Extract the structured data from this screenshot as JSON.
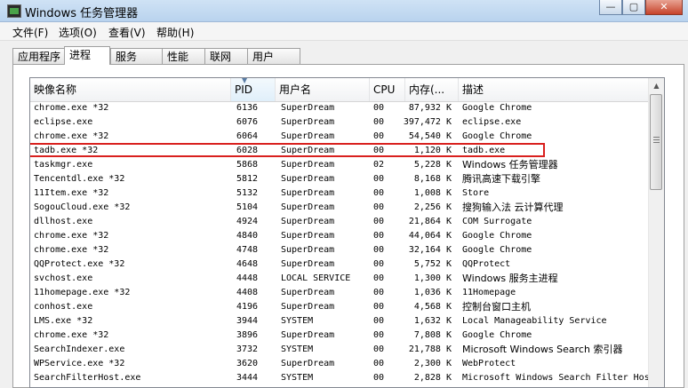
{
  "window": {
    "title": "Windows 任务管理器",
    "minimize": "—",
    "maximize": "▢",
    "close": "✕"
  },
  "menu": [
    "文件(F)",
    "选项(O)",
    "查看(V)",
    "帮助(H)"
  ],
  "tabs": [
    "应用程序",
    "进程",
    "服务",
    "性能",
    "联网",
    "用户"
  ],
  "active_tab": "进程",
  "columns": {
    "name": "映像名称",
    "pid": "PID",
    "user": "用户名",
    "cpu": "CPU",
    "mem": "内存(...",
    "desc": "描述"
  },
  "processes": [
    {
      "name": "chrome.exe *32",
      "pid": "6136",
      "user": "SuperDream",
      "cpu": "00",
      "mem": "87,932 K",
      "desc": "Google Chrome"
    },
    {
      "name": "eclipse.exe",
      "pid": "6076",
      "user": "SuperDream",
      "cpu": "00",
      "mem": "397,472 K",
      "desc": "eclipse.exe"
    },
    {
      "name": "chrome.exe *32",
      "pid": "6064",
      "user": "SuperDream",
      "cpu": "00",
      "mem": "54,540 K",
      "desc": "Google Chrome"
    },
    {
      "name": "tadb.exe *32",
      "pid": "6028",
      "user": "SuperDream",
      "cpu": "00",
      "mem": "1,120 K",
      "desc": "tadb.exe"
    },
    {
      "name": "taskmgr.exe",
      "pid": "5868",
      "user": "SuperDream",
      "cpu": "02",
      "mem": "5,228 K",
      "desc": "Windows 任务管理器"
    },
    {
      "name": "Tencentdl.exe *32",
      "pid": "5812",
      "user": "SuperDream",
      "cpu": "00",
      "mem": "8,168 K",
      "desc": "腾讯高速下载引擎"
    },
    {
      "name": "11Item.exe *32",
      "pid": "5132",
      "user": "SuperDream",
      "cpu": "00",
      "mem": "1,008 K",
      "desc": "Store"
    },
    {
      "name": "SogouCloud.exe *32",
      "pid": "5104",
      "user": "SuperDream",
      "cpu": "00",
      "mem": "2,256 K",
      "desc": "搜狗输入法 云计算代理"
    },
    {
      "name": "dllhost.exe",
      "pid": "4924",
      "user": "SuperDream",
      "cpu": "00",
      "mem": "21,864 K",
      "desc": "COM Surrogate"
    },
    {
      "name": "chrome.exe *32",
      "pid": "4840",
      "user": "SuperDream",
      "cpu": "00",
      "mem": "44,064 K",
      "desc": "Google Chrome"
    },
    {
      "name": "chrome.exe *32",
      "pid": "4748",
      "user": "SuperDream",
      "cpu": "00",
      "mem": "32,164 K",
      "desc": "Google Chrome"
    },
    {
      "name": "QQProtect.exe *32",
      "pid": "4648",
      "user": "SuperDream",
      "cpu": "00",
      "mem": "5,752 K",
      "desc": "QQProtect"
    },
    {
      "name": "svchost.exe",
      "pid": "4448",
      "user": "LOCAL SERVICE",
      "cpu": "00",
      "mem": "1,300 K",
      "desc": "Windows 服务主进程"
    },
    {
      "name": "11homepage.exe *32",
      "pid": "4408",
      "user": "SuperDream",
      "cpu": "00",
      "mem": "1,036 K",
      "desc": "11Homepage"
    },
    {
      "name": "conhost.exe",
      "pid": "4196",
      "user": "SuperDream",
      "cpu": "00",
      "mem": "4,568 K",
      "desc": "控制台窗口主机"
    },
    {
      "name": "LMS.exe *32",
      "pid": "3944",
      "user": "SYSTEM",
      "cpu": "00",
      "mem": "1,632 K",
      "desc": "Local Manageability Service"
    },
    {
      "name": "chrome.exe *32",
      "pid": "3896",
      "user": "SuperDream",
      "cpu": "00",
      "mem": "7,808 K",
      "desc": "Google Chrome"
    },
    {
      "name": "SearchIndexer.exe",
      "pid": "3732",
      "user": "SYSTEM",
      "cpu": "00",
      "mem": "21,788 K",
      "desc": "Microsoft Windows Search 索引器"
    },
    {
      "name": "WPService.exe *32",
      "pid": "3620",
      "user": "SuperDream",
      "cpu": "00",
      "mem": "2,300 K",
      "desc": "WebProtect"
    },
    {
      "name": "SearchFilterHost.exe",
      "pid": "3444",
      "user": "SYSTEM",
      "cpu": "00",
      "mem": "2,828 K",
      "desc": "Microsoft Windows Search Filter Host"
    }
  ],
  "highlighted_row_pid": "6028"
}
